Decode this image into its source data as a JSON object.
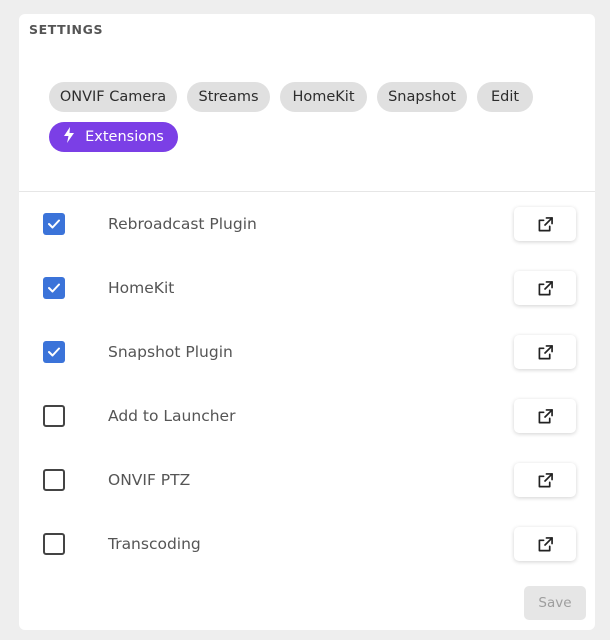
{
  "section_title": "SETTINGS",
  "tabs": [
    {
      "label": "ONVIF Camera",
      "active": false
    },
    {
      "label": "Streams",
      "active": false
    },
    {
      "label": "HomeKit",
      "active": false
    },
    {
      "label": "Snapshot",
      "active": false
    },
    {
      "label": "Edit",
      "active": false
    },
    {
      "label": "Extensions",
      "active": true,
      "icon": "lightning-bolt-icon"
    }
  ],
  "extensions": [
    {
      "label": "Rebroadcast Plugin",
      "checked": true
    },
    {
      "label": "HomeKit",
      "checked": true
    },
    {
      "label": "Snapshot Plugin",
      "checked": true
    },
    {
      "label": "Add to Launcher",
      "checked": false
    },
    {
      "label": "ONVIF PTZ",
      "checked": false
    },
    {
      "label": "Transcoding",
      "checked": false
    }
  ],
  "open_icon": "open-in-new-icon",
  "save_label": "Save",
  "save_enabled": false,
  "colors": {
    "accent": "#7b3fe6",
    "checkbox": "#3b73d9"
  }
}
